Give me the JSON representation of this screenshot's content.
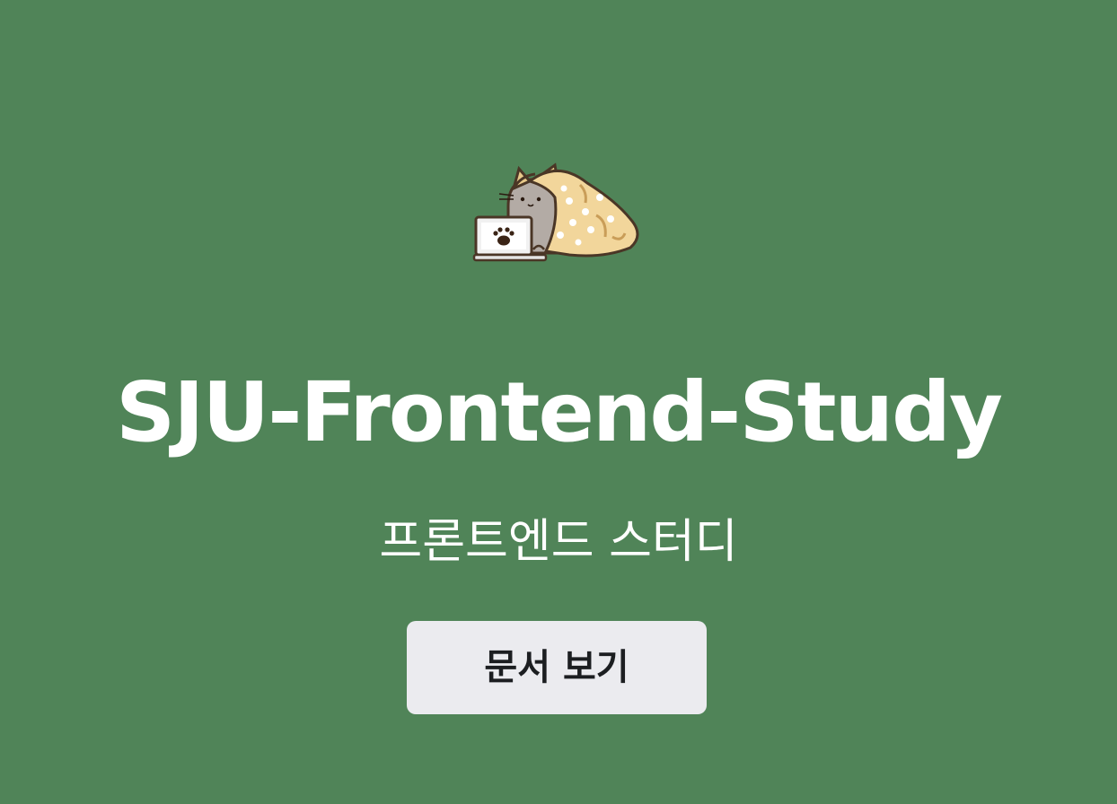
{
  "hero": {
    "title": "SJU-Frontend-Study",
    "subtitle": "프론트엔드 스터디",
    "cta_label": "문서 보기",
    "logo_icon": "cat-under-blanket-with-laptop-icon"
  },
  "colors": {
    "background": "#508458",
    "title_text": "#ffffff",
    "button_bg": "#ebebef",
    "button_text": "#1c1e21"
  }
}
